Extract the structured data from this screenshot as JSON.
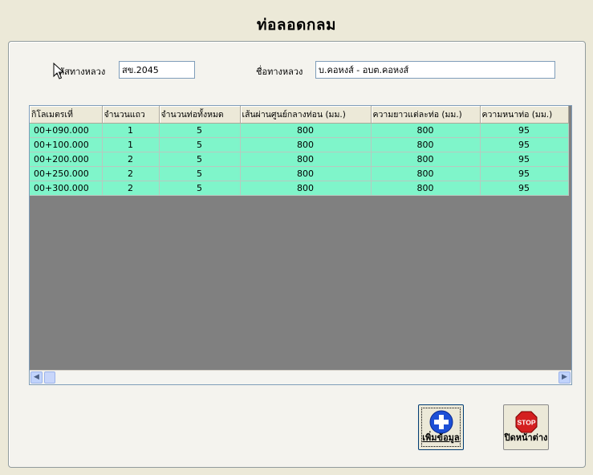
{
  "window": {
    "title": "ท่อลอดกลม"
  },
  "form": {
    "road_code_label": "รหัสทางหลวง",
    "road_code_value": "สข.2045",
    "road_name_label": "ชื่อทางหลวง",
    "road_name_value": "บ.คอหงส์ - อบต.คอหงส์"
  },
  "grid": {
    "columns": [
      "กิโลเมตรเที่",
      "จำนวนแถว",
      "จำนวนท่อทั้งหมด",
      "เส้นผ่านศูนย์กลางท่อน (มม.)",
      "ความยาวแต่ละท่อ (มม.)",
      "ความหนาท่อ (มม.)"
    ],
    "rows": [
      [
        "00+090.000",
        "1",
        "5",
        "800",
        "800",
        "95"
      ],
      [
        "00+100.000",
        "1",
        "5",
        "800",
        "800",
        "95"
      ],
      [
        "00+200.000",
        "2",
        "5",
        "800",
        "800",
        "95"
      ],
      [
        "00+250.000",
        "2",
        "5",
        "800",
        "800",
        "95"
      ],
      [
        "00+300.000",
        "2",
        "5",
        "800",
        "800",
        "95"
      ]
    ]
  },
  "buttons": {
    "add_label": "เพิ่มข้อมูล",
    "close_label": "ปิดหน้าต่าง",
    "stop_text": "STOP"
  },
  "colors": {
    "row_bg": "#7ff5ca",
    "grid_empty": "#808080",
    "add_icon": "#1c4fd6",
    "stop_icon": "#d42020"
  },
  "icons": {
    "add": "plus-circle-icon",
    "close": "stop-sign-icon",
    "scroll_left": "arrow-left-icon",
    "scroll_right": "arrow-right-icon"
  }
}
